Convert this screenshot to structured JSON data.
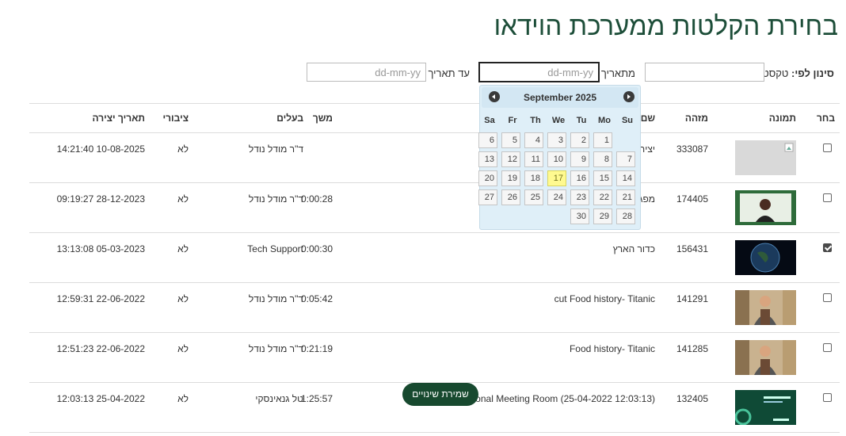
{
  "page": {
    "title": "בחירת הקלטות ממערכת הוידאו"
  },
  "filter": {
    "label_bold": "סינון לפי:",
    "label_text": "טקסט",
    "text_value": "",
    "from_label": "מתאריך",
    "from_placeholder": "dd-mm-yy",
    "to_label": "עד תאריך",
    "to_placeholder": "dd-mm-yy"
  },
  "table": {
    "headers": {
      "select": "בחר",
      "image": "תמונה",
      "id": "מזהה",
      "name": "שם",
      "duration": "משך",
      "owner": "בעלים",
      "public": "ציבורי",
      "created": "תאריך יצירה"
    },
    "rows": [
      {
        "checked": false,
        "thumb": "placeholder",
        "id": "333087",
        "name": "יצירה",
        "duration": "",
        "owner": "ד\"ר מודל נודל",
        "public": "לא",
        "created": "14:21:40 10-08-2025"
      },
      {
        "checked": false,
        "thumb": "person-green",
        "id": "174405",
        "name": "מפגש",
        "duration": "0:00:28",
        "owner": "ד\"ר מודל נודל",
        "public": "לא",
        "created": "09:19:27 28-12-2023"
      },
      {
        "checked": true,
        "thumb": "earth",
        "id": "156431",
        "name": "כדור הארץ",
        "duration": "0:00:30",
        "owner": "Tech Support",
        "public": "לא",
        "created": "13:13:08 05-03-2023"
      },
      {
        "checked": false,
        "thumb": "chef",
        "id": "141291",
        "name": "cut Food history- Titanic",
        "duration": "0:05:42",
        "owner": "ד\"ר מודל נודל",
        "public": "לא",
        "created": "12:59:31 22-06-2022"
      },
      {
        "checked": false,
        "thumb": "chef",
        "id": "141285",
        "name": "Food history- Titanic",
        "duration": "0:21:19",
        "owner": "ד\"ר מודל נודל",
        "public": "לא",
        "created": "12:51:23 22-06-2022"
      },
      {
        "checked": false,
        "thumb": "meeting",
        "id": "132405",
        "name": "Tal's Personal Meeting Room (25-04-2022 12:03:13)",
        "duration": "1:25:57",
        "owner": "טל גנאינסקי",
        "public": "לא",
        "created": "12:03:13 25-04-2022"
      }
    ]
  },
  "calendar": {
    "month_year": "September 2025",
    "prev_label": "Prev",
    "next_label": "Next",
    "weekdays": [
      "Su",
      "Mo",
      "Tu",
      "We",
      "Th",
      "Fr",
      "Sa"
    ],
    "weeks": [
      [
        "",
        "1",
        "2",
        "3",
        "4",
        "5",
        "6"
      ],
      [
        "7",
        "8",
        "9",
        "10",
        "11",
        "12",
        "13"
      ],
      [
        "14",
        "15",
        "16",
        "17",
        "18",
        "19",
        "20"
      ],
      [
        "21",
        "22",
        "23",
        "24",
        "25",
        "26",
        "27"
      ],
      [
        "28",
        "29",
        "30",
        "",
        "",
        "",
        ""
      ]
    ],
    "today": "17"
  },
  "save_button": {
    "label": "שמירת שינויים"
  },
  "colors": {
    "title": "#1d4e39",
    "save_button_bg": "#17492f",
    "calendar_bg": "#dfeff8",
    "today_bg": "#fffa90",
    "thumb_placeholder": "#d9d9d9",
    "thumb_person_bg": "#2e6b3a",
    "thumb_earth_bg": "#050a14",
    "thumb_meeting_bg": "#0f4a36"
  }
}
